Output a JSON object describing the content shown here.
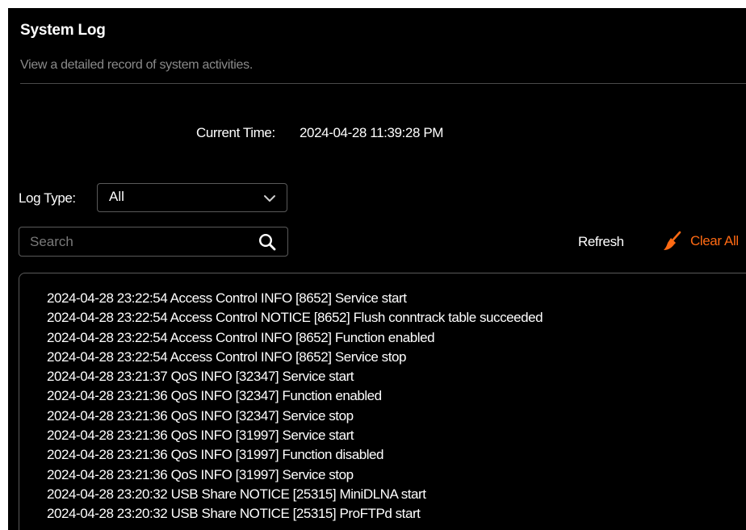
{
  "page": {
    "title": "System Log",
    "subtitle": "View a detailed record of system activities."
  },
  "current_time": {
    "label": "Current Time:",
    "value": "2024-04-28 11:39:28 PM"
  },
  "log_type": {
    "label": "Log Type:",
    "selected": "All"
  },
  "search": {
    "placeholder": "Search",
    "value": ""
  },
  "actions": {
    "refresh_label": "Refresh",
    "clear_all_label": "Clear All"
  },
  "logs": [
    "2024-04-28 23:22:54 Access Control INFO [8652] Service start",
    "2024-04-28 23:22:54 Access Control NOTICE [8652] Flush conntrack table succeeded",
    "2024-04-28 23:22:54 Access Control INFO [8652] Function enabled",
    "2024-04-28 23:22:54 Access Control INFO [8652] Service stop",
    "2024-04-28 23:21:37 QoS INFO [32347] Service start",
    "2024-04-28 23:21:36 QoS INFO [32347] Function enabled",
    "2024-04-28 23:21:36 QoS INFO [32347] Service stop",
    "2024-04-28 23:21:36 QoS INFO [31997] Service start",
    "2024-04-28 23:21:36 QoS INFO [31997] Function disabled",
    "2024-04-28 23:21:36 QoS INFO [31997] Service stop",
    "2024-04-28 23:20:32 USB Share NOTICE [25315] MiniDLNA start",
    "2024-04-28 23:20:32 USB Share NOTICE [25315] ProFTPd start"
  ],
  "icons": {
    "select_arrow": "chevron-down-icon",
    "search": "search-icon",
    "clear": "broom-icon"
  },
  "colors": {
    "background": "#000000",
    "text": "#ffffff",
    "muted_text": "#8a8a8a",
    "accent": "#ff6a13",
    "border": "#5a5a5a"
  }
}
